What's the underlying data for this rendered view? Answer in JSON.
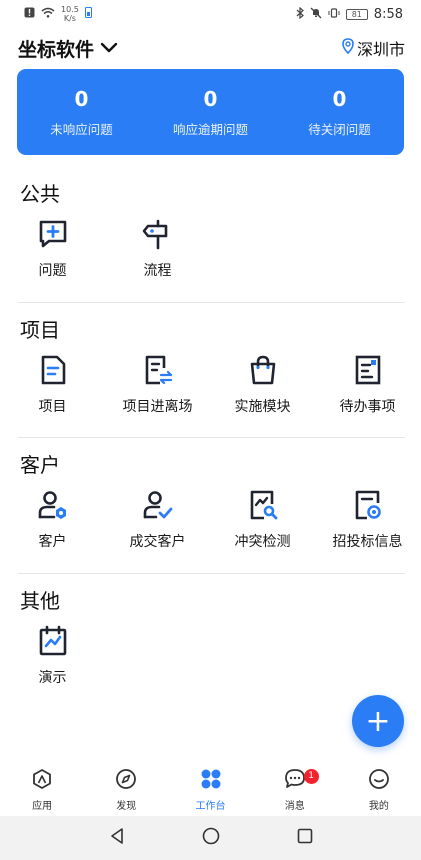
{
  "status_bar": {
    "speed_value": "10.5",
    "speed_unit": "K/s",
    "battery": "81",
    "time": "8:58"
  },
  "header": {
    "company": "坐标软件",
    "city": "深圳市"
  },
  "stats": [
    {
      "value": "0",
      "label": "未响应问题"
    },
    {
      "value": "0",
      "label": "响应逾期问题"
    },
    {
      "value": "0",
      "label": "待关闭问题"
    }
  ],
  "sections": [
    {
      "title": "公共",
      "items": [
        {
          "label": "问题",
          "icon": "chat-plus-icon"
        },
        {
          "label": "流程",
          "icon": "signpost-icon"
        }
      ]
    },
    {
      "title": "项目",
      "items": [
        {
          "label": "项目",
          "icon": "document-icon"
        },
        {
          "label": "项目进离场",
          "icon": "document-transfer-icon"
        },
        {
          "label": "实施模块",
          "icon": "shopping-bag-icon"
        },
        {
          "label": "待办事项",
          "icon": "todo-note-icon"
        }
      ]
    },
    {
      "title": "客户",
      "items": [
        {
          "label": "客户",
          "icon": "user-gear-icon"
        },
        {
          "label": "成交客户",
          "icon": "user-check-icon"
        },
        {
          "label": "冲突检测",
          "icon": "chart-search-icon"
        },
        {
          "label": "招投标信息",
          "icon": "document-target-icon"
        }
      ]
    },
    {
      "title": "其他",
      "items": [
        {
          "label": "演示",
          "icon": "presentation-icon"
        }
      ]
    }
  ],
  "fab": {
    "label": "+"
  },
  "tabs": [
    {
      "label": "应用"
    },
    {
      "label": "发现"
    },
    {
      "label": "工作台"
    },
    {
      "label": "消息",
      "badge": "1"
    },
    {
      "label": "我的"
    }
  ],
  "colors": {
    "accent": "#2a7df5",
    "badge": "#f5222d",
    "icon_dark": "#1f2430"
  }
}
